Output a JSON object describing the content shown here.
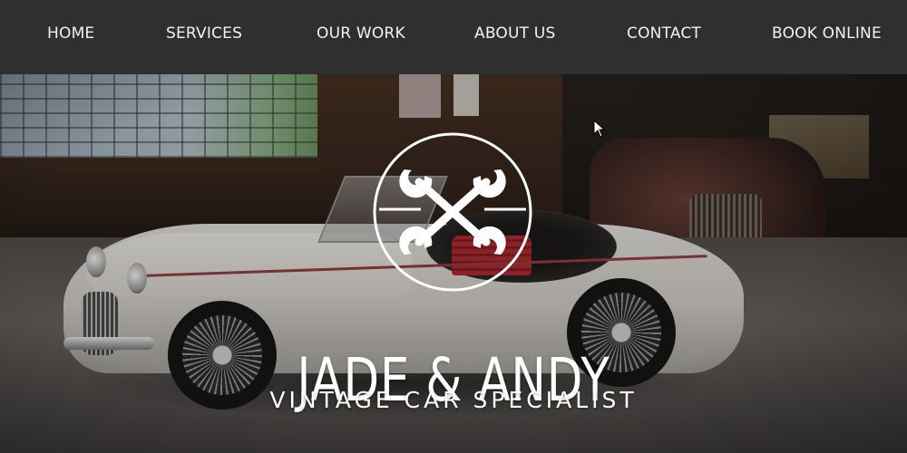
{
  "nav": {
    "items": [
      {
        "label": "HOME"
      },
      {
        "label": "SERVICES"
      },
      {
        "label": "OUR WORK"
      },
      {
        "label": "ABOUT US"
      },
      {
        "label": "CONTACT"
      },
      {
        "label": "BOOK ONLINE"
      }
    ]
  },
  "hero": {
    "title": "JADE & ANDY",
    "subtitle": "VINTAGE CAR SPECIALIST",
    "logo_icon": "crossed-wrenches-icon"
  },
  "colors": {
    "nav_background": "#2f2f2f",
    "nav_text": "#f2f2f2",
    "hero_text": "#ffffff",
    "accent_seat_red": "#b12c34"
  }
}
